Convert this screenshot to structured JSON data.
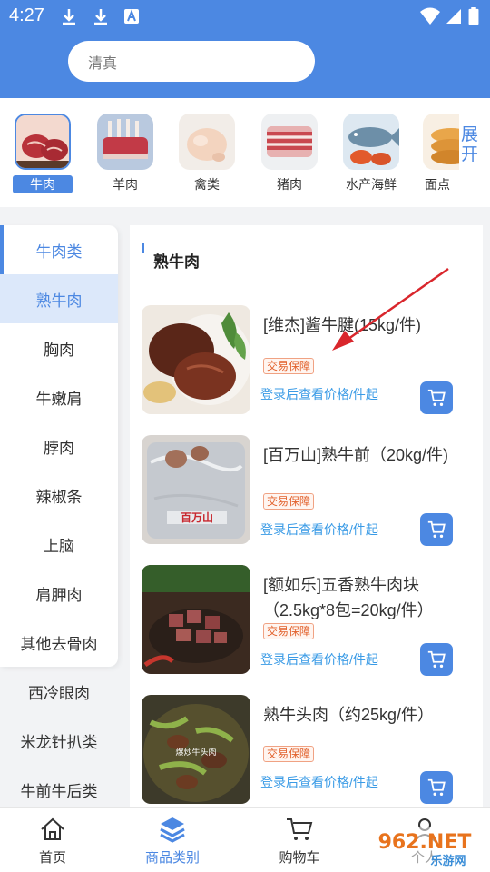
{
  "status_bar": {
    "time": "4:27"
  },
  "search": {
    "value": "清真"
  },
  "categories": [
    {
      "label": "牛肉",
      "icon": "beef-image"
    },
    {
      "label": "羊肉",
      "icon": "lamb-ribs-image"
    },
    {
      "label": "禽类",
      "icon": "poultry-image"
    },
    {
      "label": "猪肉",
      "icon": "pork-belly-image"
    },
    {
      "label": "水产海鲜",
      "icon": "fish-image"
    },
    {
      "label": "面点",
      "icon": "pastry-image"
    }
  ],
  "expand_label": "展开",
  "sidebar": {
    "items": [
      "牛肉类",
      "熟牛肉",
      "胸肉",
      "牛嫩肩",
      "脖肉",
      "辣椒条",
      "上脑",
      "肩胛肉",
      "其他去骨肉",
      "西冷眼肉",
      "米龙针扒类",
      "牛前牛后类"
    ]
  },
  "main": {
    "section_title": "熟牛肉",
    "products": [
      {
        "name": "[维杰]酱牛腱(15kg/件)",
        "badge": "交易保障",
        "price_text": "登录后查看价格/件起"
      },
      {
        "name": "[百万山]熟牛前（20kg/件)",
        "badge": "交易保障",
        "price_text": "登录后查看价格/件起"
      },
      {
        "name": "[额如乐]五香熟牛肉块（2.5kg*8包=20kg/件）",
        "badge": "交易保障",
        "price_text": "登录后查看价格/件起"
      },
      {
        "name": "熟牛头肉（约25kg/件）",
        "badge": "交易保障",
        "price_text": "登录后查看价格/件起"
      }
    ],
    "package_print": "百万山",
    "dish_print": "爆炒牛头肉"
  },
  "bottom_nav": [
    {
      "label": "首页",
      "icon": "home-icon"
    },
    {
      "label": "商品类别",
      "icon": "layers-icon"
    },
    {
      "label": "购物车",
      "icon": "cart-icon"
    },
    {
      "label": "个人",
      "icon": "person-icon"
    }
  ],
  "watermark": {
    "text": "962.NET",
    "subtext": "乐游网"
  },
  "colors": {
    "accent": "#4c88e2",
    "price": "#3a9be6",
    "badge": "#e2622d",
    "annotation_arrow": "#d9262c"
  }
}
